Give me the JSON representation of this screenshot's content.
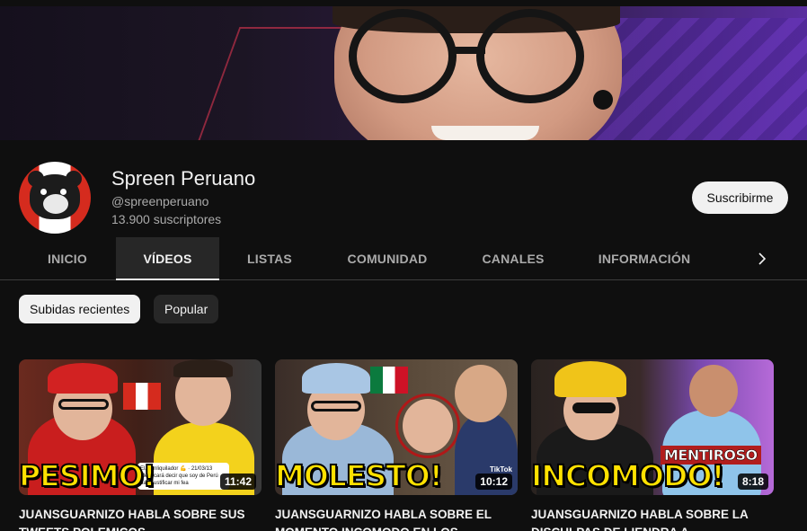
{
  "channel": {
    "name": "Spreen Peruano",
    "handle": "@spreenperuano",
    "subscribers": "13.900 suscriptores",
    "subscribe_label": "Suscribirme"
  },
  "tabs": [
    {
      "label": "INICIO",
      "active": false
    },
    {
      "label": "VÍDEOS",
      "active": true
    },
    {
      "label": "LISTAS",
      "active": false
    },
    {
      "label": "COMUNIDAD",
      "active": false
    },
    {
      "label": "CANALES",
      "active": false
    },
    {
      "label": "INFORMACIÓN",
      "active": false
    }
  ],
  "tabs_next_icon": "chevron-right-icon",
  "chips": [
    {
      "label": "Subidas recientes",
      "selected": true
    },
    {
      "label": "Popular",
      "selected": false
    }
  ],
  "videos": [
    {
      "thumbnail_text": "PESIMO!",
      "duration": "11:42",
      "title": "JUANSGUARNIZO HABLA SOBRE SUS TWEETS POLEMICOS",
      "tweet_user": "ElJuanliquilador 💪 · 21/03/13",
      "tweet_text": "Me tocará decir que soy de Perú para justificar mi fea"
    },
    {
      "thumbnail_text": "MOLESTO!",
      "duration": "10:12",
      "title": "JUANSGUARNIZO HABLA SOBRE EL MOMENTO INCOMODO EN LOS",
      "watermark": "TikTok"
    },
    {
      "thumbnail_text": "INCOMODO!",
      "duration": "8:18",
      "title": "JUANSGUARNIZO HABLA SOBRE LA DISCULPAS DE LIENDRA A",
      "overlay_label": "MENTIROSO"
    }
  ],
  "colors": {
    "background": "#0f0f0f",
    "text_primary": "#f1f1f1",
    "text_secondary": "#aaaaaa",
    "chip_bg": "#272727",
    "caption_yellow": "#ffe100"
  }
}
